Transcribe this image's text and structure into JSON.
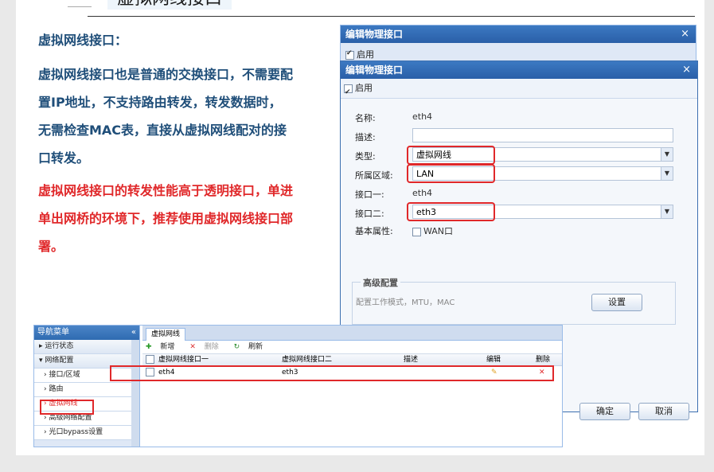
{
  "slide": {
    "title": "虚拟网线接口",
    "heading": "虚拟网线接口：",
    "paragraph1": "虚拟网线接口也是普通的交换接口，不需要配置IP地址，不支持路由转发，转发数据时，无需检查MAC表，直接从虚拟网线配对的接口转发。",
    "paragraph2": "虚拟网线接口的转发性能高于透明接口，单进单出网桥的环境下，推荐使用虚拟网线接口部署。"
  },
  "dialog_back": {
    "title": "编辑物理接口",
    "enable_label": "启用"
  },
  "dialog": {
    "title": "编辑物理接口",
    "close": "×",
    "enable_label": "启用",
    "name_label": "名称:",
    "name_value": "eth4",
    "desc_label": "描述:",
    "desc_value": "",
    "type_label": "类型:",
    "type_value": "虚拟网线",
    "zone_label": "所属区域:",
    "zone_value": "LAN",
    "if1_label": "接口一:",
    "if1_value": "eth4",
    "if2_label": "接口二:",
    "if2_value": "eth3",
    "basic_label": "基本属性:",
    "wan_label": "WAN口",
    "advanced_legend": "高级配置",
    "advanced_desc": "配置工作模式，MTU，MAC",
    "settings_button": "设置",
    "ok_button": "确定",
    "cancel_button": "取消"
  },
  "nav": {
    "title": "导航菜单",
    "collapse": "«",
    "items": [
      "运行状态",
      "网络配置",
      "接口/区域",
      "路由",
      "虚拟网线",
      "高级网络配置",
      "光口bypass设置"
    ]
  },
  "panel": {
    "tab": "虚拟网线",
    "add": "新增",
    "delete": "删除",
    "refresh": "刷新",
    "columns": [
      "虚拟网线接口一",
      "虚拟网线接口二",
      "描述",
      "编辑",
      "删除"
    ],
    "rows": [
      {
        "if1": "eth4",
        "if2": "eth3",
        "desc": "",
        "edit": "✎",
        "delete": "✕"
      }
    ]
  }
}
